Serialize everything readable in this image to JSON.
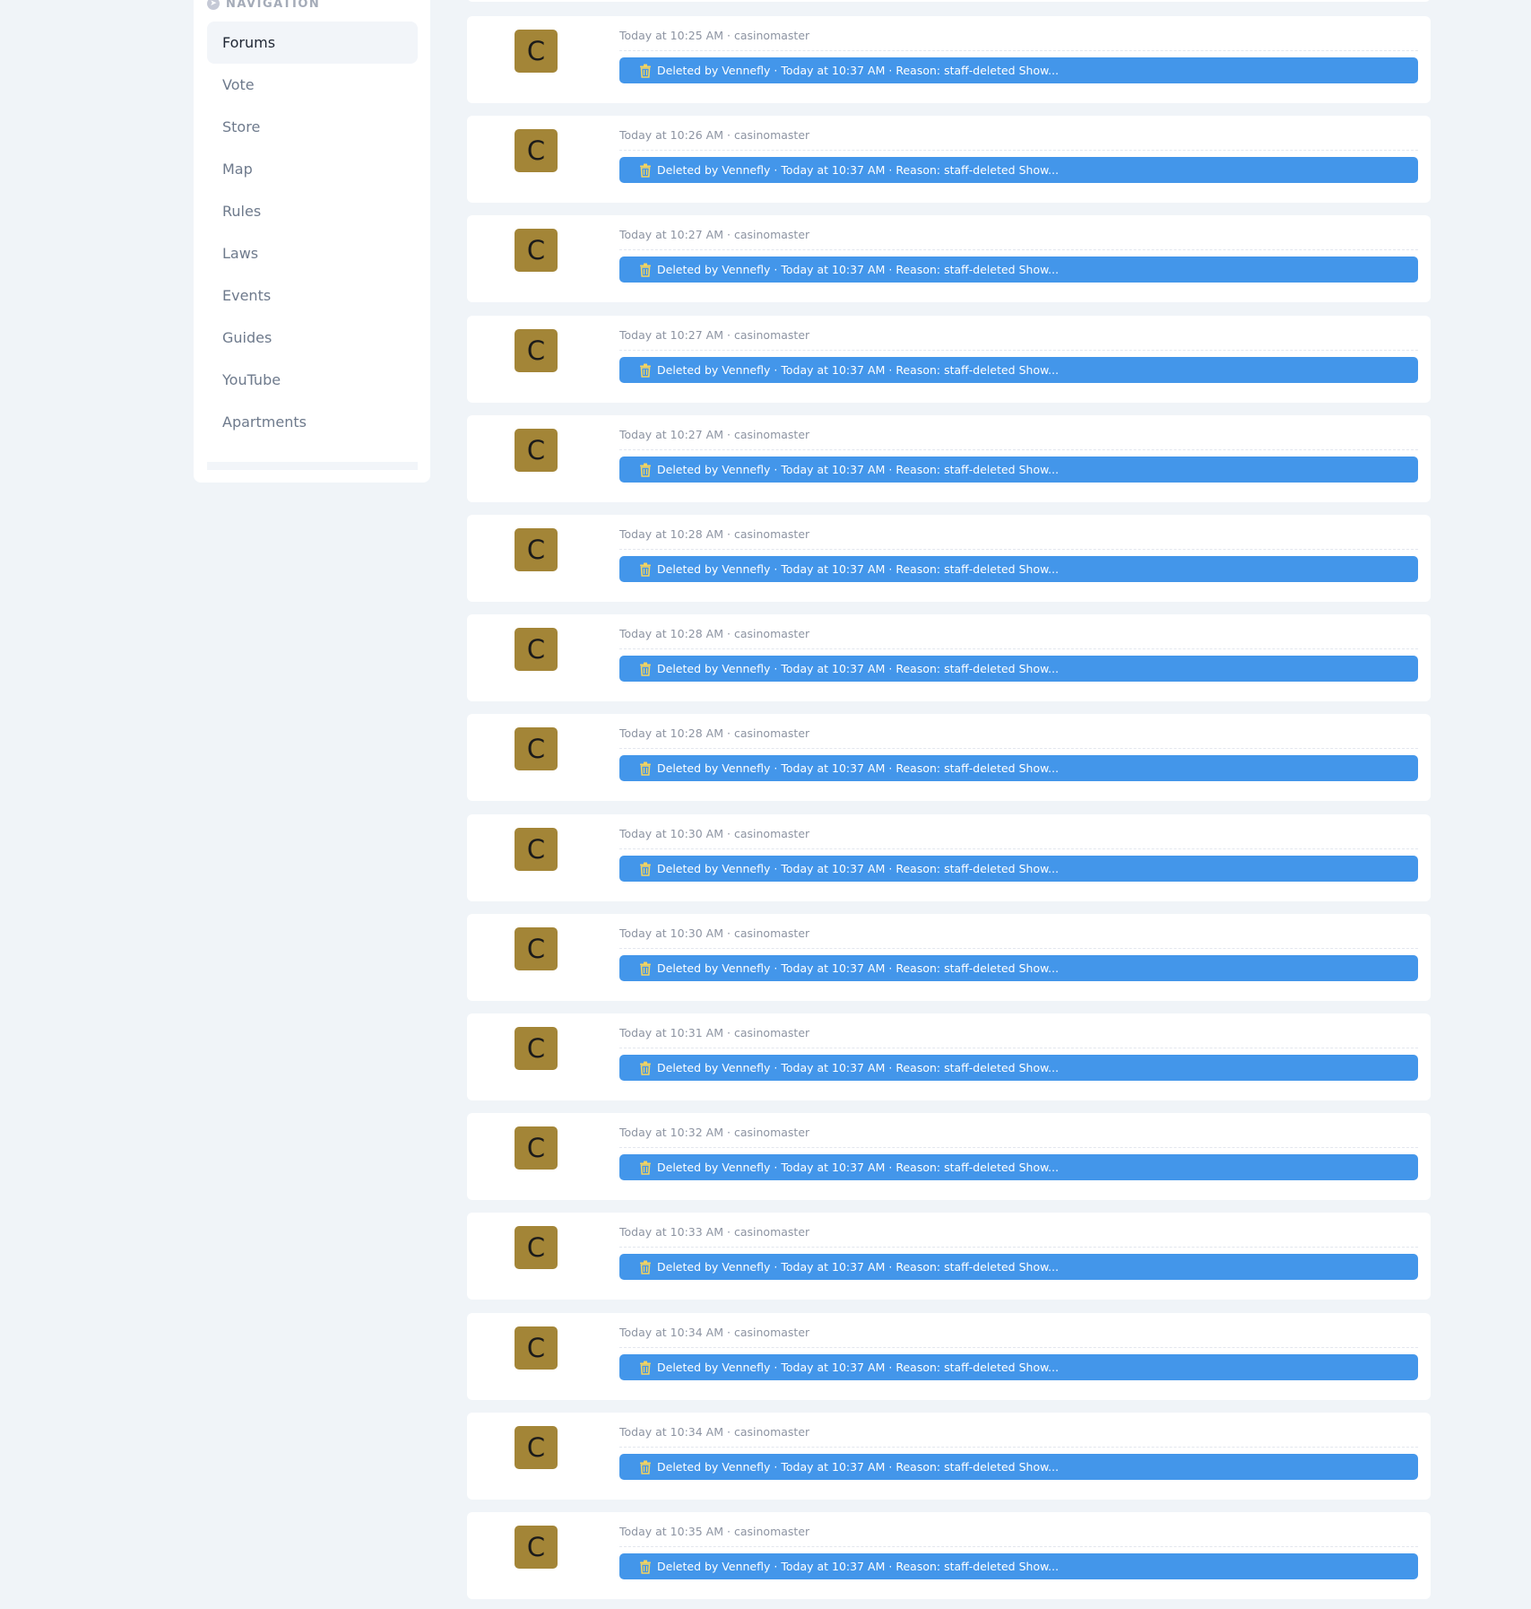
{
  "sidebar": {
    "header": "NAVIGATION",
    "items": [
      {
        "label": "Forums",
        "active": true
      },
      {
        "label": "Vote"
      },
      {
        "label": "Store"
      },
      {
        "label": "Map"
      },
      {
        "label": "Rules"
      },
      {
        "label": "Laws"
      },
      {
        "label": "Events"
      },
      {
        "label": "Guides"
      },
      {
        "label": "YouTube"
      },
      {
        "label": "Apartments"
      }
    ]
  },
  "colors": {
    "avatar_bg": "#a38537",
    "deleted_bar": "#4396ea",
    "trash_icon": "#f4d35e"
  },
  "separator": "·",
  "deleted_notice": {
    "prefix": "Deleted by",
    "moderator": "Vennefly",
    "time": "Today at 10:37 AM",
    "reason": "Reason: staff-deleted",
    "show": "Show..."
  },
  "posts": [
    {
      "initial": "C",
      "time": "Today at 10:25 AM",
      "author": "casinomaster"
    },
    {
      "initial": "C",
      "time": "Today at 10:26 AM",
      "author": "casinomaster"
    },
    {
      "initial": "C",
      "time": "Today at 10:27 AM",
      "author": "casinomaster"
    },
    {
      "initial": "C",
      "time": "Today at 10:27 AM",
      "author": "casinomaster"
    },
    {
      "initial": "C",
      "time": "Today at 10:27 AM",
      "author": "casinomaster"
    },
    {
      "initial": "C",
      "time": "Today at 10:28 AM",
      "author": "casinomaster"
    },
    {
      "initial": "C",
      "time": "Today at 10:28 AM",
      "author": "casinomaster"
    },
    {
      "initial": "C",
      "time": "Today at 10:28 AM",
      "author": "casinomaster"
    },
    {
      "initial": "C",
      "time": "Today at 10:30 AM",
      "author": "casinomaster"
    },
    {
      "initial": "C",
      "time": "Today at 10:30 AM",
      "author": "casinomaster"
    },
    {
      "initial": "C",
      "time": "Today at 10:31 AM",
      "author": "casinomaster"
    },
    {
      "initial": "C",
      "time": "Today at 10:32 AM",
      "author": "casinomaster"
    },
    {
      "initial": "C",
      "time": "Today at 10:33 AM",
      "author": "casinomaster"
    },
    {
      "initial": "C",
      "time": "Today at 10:34 AM",
      "author": "casinomaster"
    },
    {
      "initial": "C",
      "time": "Today at 10:34 AM",
      "author": "casinomaster"
    },
    {
      "initial": "C",
      "time": "Today at 10:35 AM",
      "author": "casinomaster"
    }
  ]
}
